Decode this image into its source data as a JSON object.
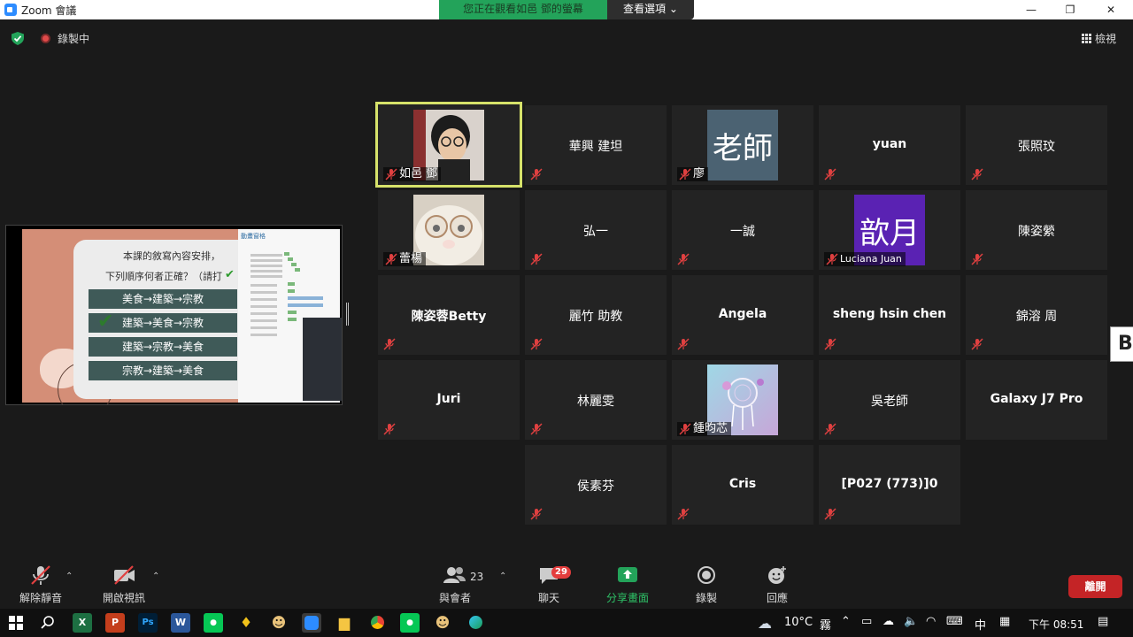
{
  "window": {
    "title": "Zoom 會議",
    "viewing_banner": "您正在觀看如邑 鄧的螢幕",
    "view_options": "查看選項"
  },
  "meeting_bar": {
    "recording_label": "錄製中",
    "view_label": "檢視"
  },
  "shared_slide": {
    "question_line1": "本課的敘寫內容安排，",
    "question_line2": "下列順序何者正確？（請打",
    "options": [
      "美食→建築→宗教",
      "建築→美食→宗教",
      "建築→宗教→美食",
      "宗教→建築→美食"
    ],
    "correct_option_index": 1,
    "side_panel_title": "動畫窗格"
  },
  "participants": [
    {
      "name": "如邑 鄧",
      "muted": true,
      "active_speaker": true,
      "avatar": "photo-girl-glasses"
    },
    {
      "name": "華興 建坦",
      "muted": true
    },
    {
      "name": "廖",
      "muted": true,
      "avatar_text": "老師",
      "avatar_color": "#4b6272"
    },
    {
      "name": "yuan",
      "muted": true
    },
    {
      "name": "張照玟",
      "muted": true
    },
    {
      "name": "蕾楊",
      "muted": true,
      "avatar": "photo-plush-glasses"
    },
    {
      "name": "弘一",
      "muted": true
    },
    {
      "name": "一誠",
      "muted": true
    },
    {
      "name": "Luciana Juan",
      "muted": true,
      "avatar_text": "歆月",
      "avatar_color": "#5a22b3"
    },
    {
      "name": "陳姿縈",
      "muted": true
    },
    {
      "name": "陳姿蓉Betty",
      "muted": true
    },
    {
      "name": "麗竹 助教",
      "muted": true
    },
    {
      "name": "Angela",
      "muted": true
    },
    {
      "name": "sheng hsin chen",
      "muted": true
    },
    {
      "name": "錦溶 周",
      "muted": true
    },
    {
      "name": "Juri",
      "muted": true
    },
    {
      "name": "林麗雯",
      "muted": true
    },
    {
      "name": "鍾昀芯",
      "muted": true,
      "avatar": "photo-dreamcatcher"
    },
    {
      "name": "吳老師",
      "muted": true
    },
    {
      "name": "Galaxy J7 Pro",
      "muted": true
    },
    {
      "name": "侯素芬",
      "muted": true
    },
    {
      "name": "Cris",
      "muted": true
    },
    {
      "name": "[P027 (773)]0",
      "muted": true
    }
  ],
  "right_edge_label": "Bo",
  "toolbar": {
    "unmute_label": "解除靜音",
    "start_video_label": "開啟視訊",
    "participants_label": "與會者",
    "participants_count": "23",
    "chat_label": "聊天",
    "chat_badge": "29",
    "share_label": "分享畫面",
    "record_label": "錄製",
    "reactions_label": "回應",
    "leave_label": "離開"
  },
  "taskbar": {
    "temperature": "10°C",
    "weather": "霧",
    "ime": "中",
    "time": "下午 08:51"
  },
  "colors": {
    "active_speaker_border": "#d6e26a",
    "share_green": "#23a35a",
    "leave_red": "#c42426",
    "mute_red": "#e04040"
  }
}
